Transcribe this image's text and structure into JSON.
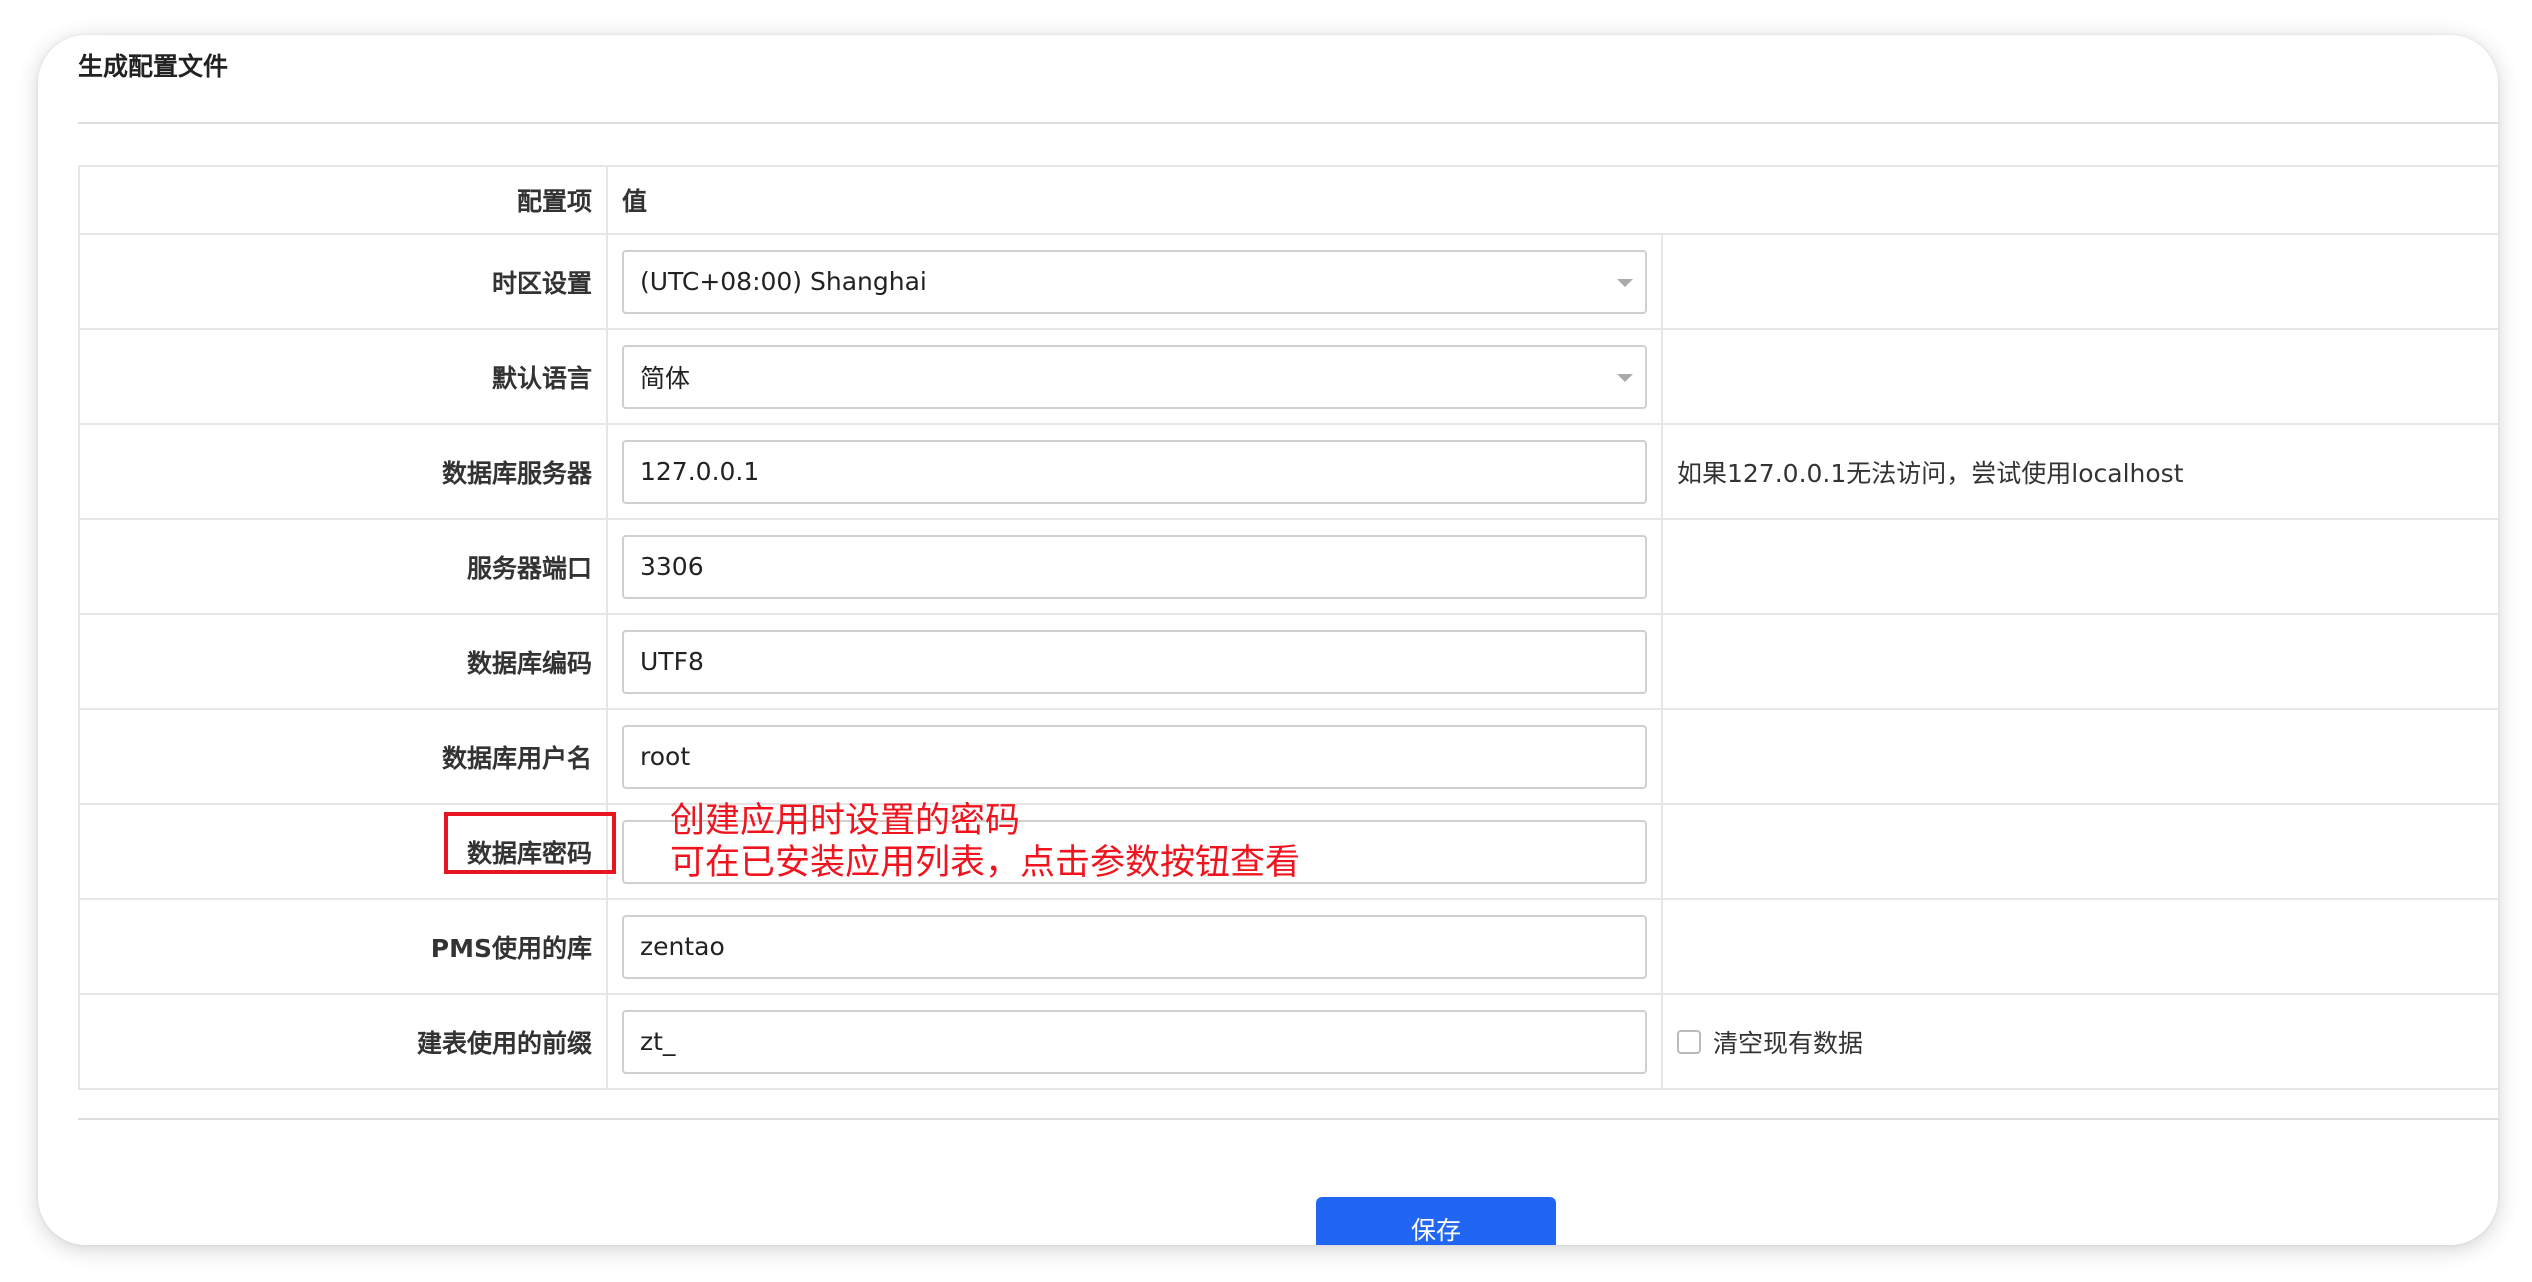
{
  "panel": {
    "title": "生成配置文件"
  },
  "table": {
    "header": {
      "label": "配置项",
      "value": "值"
    },
    "rows": [
      {
        "label": "时区设置",
        "value": "(UTC+08:00) Shanghai",
        "type": "select",
        "extra": ""
      },
      {
        "label": "默认语言",
        "value": "简体",
        "type": "select",
        "extra": ""
      },
      {
        "label": "数据库服务器",
        "value": "127.0.0.1",
        "type": "input",
        "extra": "如果127.0.0.1无法访问，尝试使用localhost"
      },
      {
        "label": "服务器端口",
        "value": "3306",
        "type": "input",
        "extra": ""
      },
      {
        "label": "数据库编码",
        "value": "UTF8",
        "type": "input",
        "extra": ""
      },
      {
        "label": "数据库用户名",
        "value": "root",
        "type": "input",
        "extra": ""
      },
      {
        "label": "数据库密码",
        "value": "",
        "type": "password",
        "extra": ""
      },
      {
        "label": "PMS使用的库",
        "value": "zentao",
        "type": "input",
        "extra": ""
      },
      {
        "label": "建表使用的前缀",
        "value": "zt_",
        "type": "input",
        "extra": "清空现有数据",
        "checkbox_checked": false
      }
    ]
  },
  "annotation": {
    "line1": "创建应用时设置的密码",
    "line2": "可在已安装应用列表，点击参数按钮查看",
    "color": "#f0141f"
  },
  "actions": {
    "save_label": "保存",
    "save_color": "#2166f3"
  }
}
